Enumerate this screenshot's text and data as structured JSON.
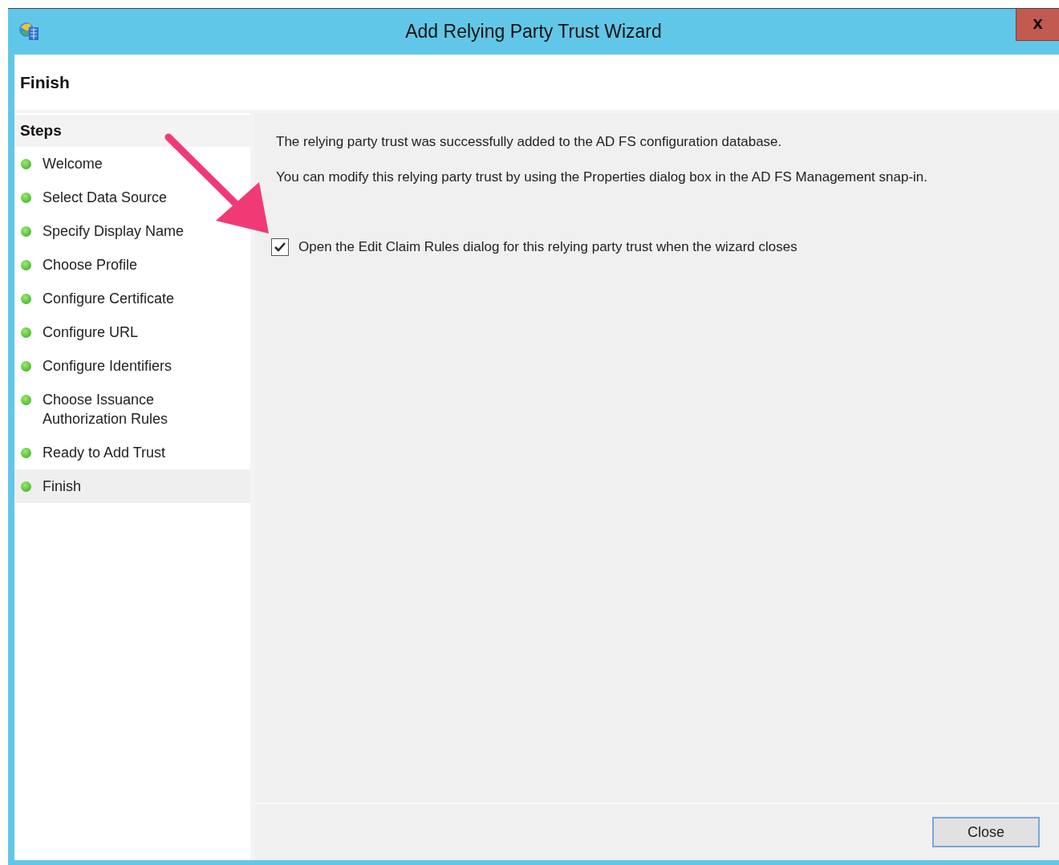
{
  "window": {
    "title": "Add Relying Party Trust Wizard",
    "close_glyph": "x"
  },
  "header": {
    "title": "Finish"
  },
  "steps": {
    "heading": "Steps",
    "items": [
      {
        "label": "Welcome",
        "selected": false
      },
      {
        "label": "Select Data Source",
        "selected": false
      },
      {
        "label": "Specify Display Name",
        "selected": false
      },
      {
        "label": "Choose Profile",
        "selected": false
      },
      {
        "label": "Configure Certificate",
        "selected": false
      },
      {
        "label": "Configure URL",
        "selected": false
      },
      {
        "label": "Configure Identifiers",
        "selected": false
      },
      {
        "label": "Choose Issuance Authorization Rules",
        "selected": false
      },
      {
        "label": "Ready to Add Trust",
        "selected": false
      },
      {
        "label": "Finish",
        "selected": true
      }
    ]
  },
  "content": {
    "messages": [
      "The relying party trust was successfully added to the AD FS configuration database.",
      "You can modify this relying party trust by using the Properties dialog box in the AD FS Management snap-in."
    ],
    "checkbox": {
      "label": "Open the Edit Claim Rules dialog for this relying party trust when the wizard closes",
      "checked": true
    }
  },
  "buttons": [
    "Close"
  ]
}
